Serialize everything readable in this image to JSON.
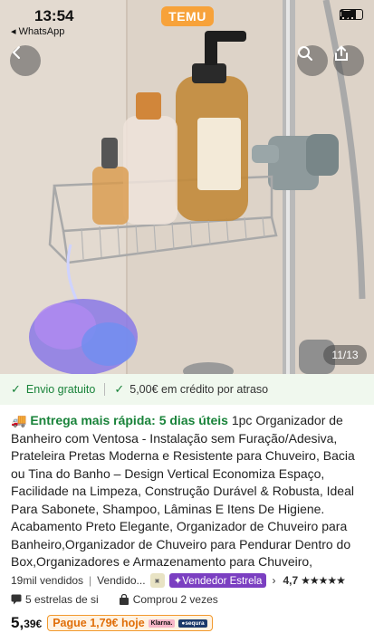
{
  "status_bar": {
    "time": "13:54",
    "back_app": "◂ WhatsApp",
    "brand": "TEMU"
  },
  "gallery": {
    "counter": "11/13"
  },
  "shipping": {
    "free": "Envio gratuito",
    "credit": "5,00€ em crédito por atraso"
  },
  "product": {
    "delivery": "Entrega mais rápida: 5 dias úteis",
    "title": "1pc Organizador de Banheiro com Ventosa - Instalação sem Furação/Adesiva, Prateleira Pretas Moderna e Resistente para Chuveiro, Bacia ou Tina do Banho – Design Vertical Economiza Espaço, Facilidade na Limpeza, Construção Durável & Robusta, Ideal Para Sabonete, Shampoo, Lâminas E Itens De Higiene. Acabamento Preto Elegante, Organizador de Chuveiro para Banheiro,Organizador de Chuveiro para Pendurar Dentro do Box,Organizadores e Armazenamento para Chuveiro,",
    "sold": "19mil vendidos",
    "seller": "Vendido...",
    "star_seller": "✦Vendedor Estrela",
    "rating": "4,7",
    "stars": "★★★★★",
    "review_note": "5 estrelas de si",
    "bought": "Comprou 2 vezes",
    "price_main": "5,",
    "price_cents": "39€",
    "pay_later": "Pague 1,79€ hoje",
    "klarna": "Klarna.",
    "sequra": "●sequra"
  },
  "colors": {
    "accent_green": "#19833a",
    "brand_orange": "#f7a23a",
    "star_seller_purple": "#7b3fc1"
  }
}
